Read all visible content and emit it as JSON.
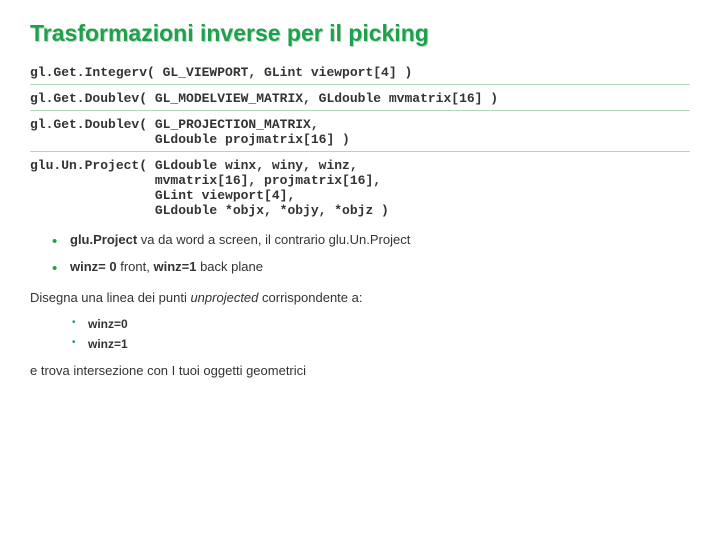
{
  "title": "Trasformazioni inverse per il picking",
  "code": {
    "l1": "gl.Get.Integerv( GL_VIEWPORT, GLint viewport[4] )",
    "l2": "gl.Get.Doublev( GL_MODELVIEW_MATRIX, GLdouble mvmatrix[16] )",
    "l3": "gl.Get.Doublev( GL_PROJECTION_MATRIX,\n                GLdouble projmatrix[16] )",
    "l4": "glu.Un.Project( GLdouble winx, winy, winz,\n                mvmatrix[16], projmatrix[16],\n                GLint viewport[4],\n                GLdouble *objx, *objy, *objz )"
  },
  "bullets": {
    "b1_fn": "glu.Project",
    "b1_rest": " va da word a screen, il contrario glu.Un.Project",
    "b2_a": "winz= 0",
    "b2_mid": " front, ",
    "b2_b": "winz=1",
    "b2_end": " back plane"
  },
  "para1_a": "Disegna una linea dei punti ",
  "para1_i": "unprojected",
  "para1_b": " corrispondente a:",
  "sub": {
    "s1": "winz=0",
    "s2": "winz=1"
  },
  "para2": "e trova intersezione con I tuoi oggetti geometrici"
}
